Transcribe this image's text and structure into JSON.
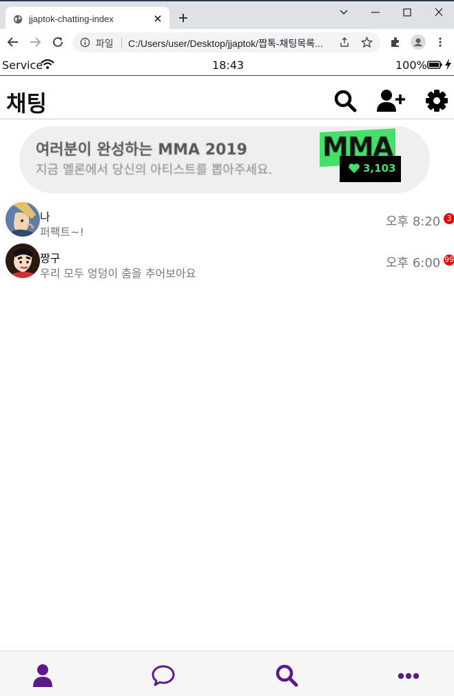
{
  "browser": {
    "tab_title": "jjaptok-chatting-index",
    "omnibox_scheme_label": "파일",
    "url": "C:/Users/user/Desktop/jjaptok/짭톡-채팅목록...",
    "icons": [
      "globe-icon",
      "close-icon",
      "plus-icon",
      "minimize-icon",
      "maximize-icon",
      "window-close-icon",
      "back-icon",
      "forward-icon",
      "reload-icon",
      "info-icon",
      "share-icon",
      "star-icon",
      "extensions-icon",
      "profile-icon",
      "menu-dots-icon",
      "tab-search-icon"
    ]
  },
  "status_bar": {
    "carrier": "Service",
    "time": "18:43",
    "battery": "100%"
  },
  "header": {
    "title": "채팅",
    "icons": [
      "search-icon",
      "add-friend-icon",
      "settings-icon"
    ]
  },
  "banner": {
    "title": "여러분이 완성하는 MMA 2019",
    "subtitle": "지금 멜론에서 당신의 아티스트를 뽑아주세요.",
    "logo_text": "MMA",
    "vote_count": "3,103",
    "accent_color": "#45e06a"
  },
  "chats": [
    {
      "name": "나",
      "preview": "퍼팩트~!",
      "time": "오후 8:20",
      "unread": "3"
    },
    {
      "name": "짱구",
      "preview": "우리 모두 엉덩이 춤을 추어보아요",
      "time": "오후 6:00",
      "unread": "99"
    }
  ],
  "bottom_nav": {
    "icons": [
      "friends-icon",
      "chats-icon",
      "search-icon",
      "more-icon"
    ],
    "color": "#5b1a8c"
  }
}
